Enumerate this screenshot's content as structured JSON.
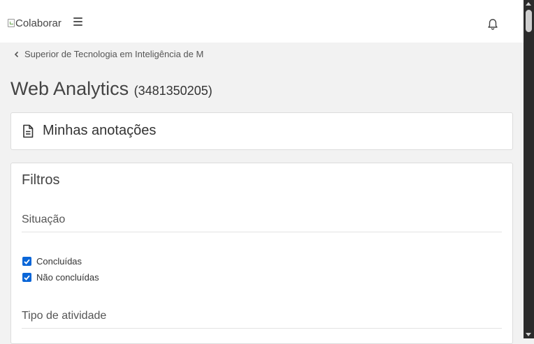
{
  "header": {
    "logo_alt": "Colaborar",
    "menu_icon": "hamburger-menu-icon",
    "notification_icon": "bell-icon"
  },
  "breadcrumb": {
    "label": "Superior de Tecnologia em Inteligência de M",
    "icon": "chevron-left-icon"
  },
  "page": {
    "title": "Web Analytics",
    "code": "(3481350205)"
  },
  "notes": {
    "label": "Minhas anotações",
    "icon": "document-icon"
  },
  "filters": {
    "title": "Filtros",
    "situation": {
      "title": "Situação",
      "options": [
        {
          "label": "Concluídas",
          "checked": true
        },
        {
          "label": "Não concluídas",
          "checked": true
        }
      ]
    },
    "activity_type": {
      "title": "Tipo de atividade"
    }
  },
  "colors": {
    "checkbox": "#0a66d8",
    "background": "#f2f2f2",
    "card": "#ffffff"
  }
}
